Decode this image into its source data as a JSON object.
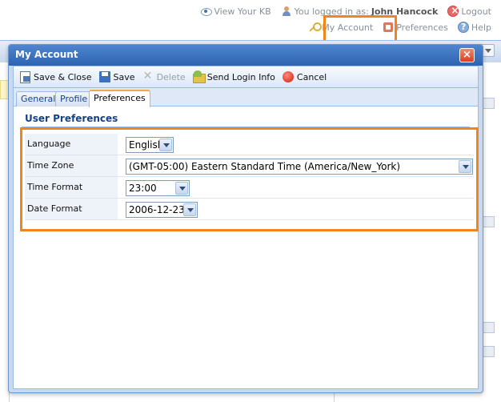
{
  "top_nav": {
    "view_kb": "View Your KB",
    "logged_in_prefix": "You logged in as:",
    "user_name": "John Hancock",
    "logout": "Logout",
    "my_account": "My Account",
    "preferences": "Preferences",
    "help": "Help"
  },
  "window": {
    "title": "My Account",
    "close_glyph": "×"
  },
  "toolbar": {
    "save_close": "Save & Close",
    "save": "Save",
    "delete": "Delete",
    "send_login": "Send Login Info",
    "cancel": "Cancel"
  },
  "tabs": [
    {
      "label": "General"
    },
    {
      "label": "Profile"
    },
    {
      "label": "Preferences",
      "active": true
    }
  ],
  "section_title": "User Preferences",
  "fields": [
    {
      "label": "Language",
      "value": "English"
    },
    {
      "label": "Time Zone",
      "value": "(GMT-05:00) Eastern Standard Time (America/New_York)"
    },
    {
      "label": "Time Format",
      "value": "23:00"
    },
    {
      "label": "Date Format",
      "value": "2006-12-23"
    }
  ],
  "colors": {
    "highlight": "#f0851e",
    "header_blue": "#2d63b0",
    "border_blue": "#99bbe8"
  }
}
